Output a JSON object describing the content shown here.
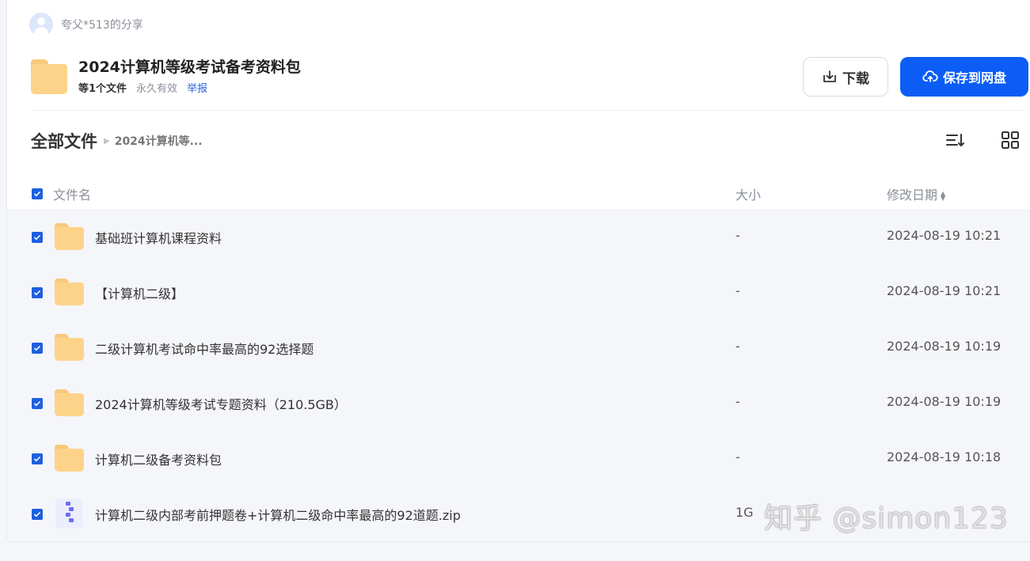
{
  "sharer": {
    "name": "夸父*513的分享"
  },
  "share": {
    "title": "2024计算机等级考试备考资料包",
    "file_count": "等1个文件",
    "validity": "永久有效",
    "report": "举报"
  },
  "buttons": {
    "download": "下载",
    "save": "保存到网盘"
  },
  "breadcrumb": {
    "root": "全部文件",
    "current": "2024计算机等..."
  },
  "table": {
    "columns": {
      "name": "文件名",
      "size": "大小",
      "date": "修改日期"
    },
    "rows": [
      {
        "type": "folder",
        "name": "基础班计算机课程资料",
        "size": "-",
        "date": "2024-08-19 10:21"
      },
      {
        "type": "folder",
        "name": "【计算机二级】",
        "size": "-",
        "date": "2024-08-19 10:21"
      },
      {
        "type": "folder",
        "name": "二级计算机考试命中率最高的92选择题",
        "size": "-",
        "date": "2024-08-19 10:19"
      },
      {
        "type": "folder",
        "name": "2024计算机等级考试专题资料（210.5GB）",
        "size": "-",
        "date": "2024-08-19 10:19"
      },
      {
        "type": "folder",
        "name": "计算机二级备考资料包",
        "size": "-",
        "date": "2024-08-19 10:18"
      },
      {
        "type": "zip",
        "name": "计算机二级内部考前押题卷+计算机二级命中率最高的92道题.zip",
        "size": "1G",
        "date": ""
      }
    ]
  },
  "watermark": {
    "text": "知乎 @simon123"
  },
  "colors": {
    "accent": "#0b5df5",
    "folder": "#fdd38a",
    "checkbox": "#1d5fe0"
  }
}
